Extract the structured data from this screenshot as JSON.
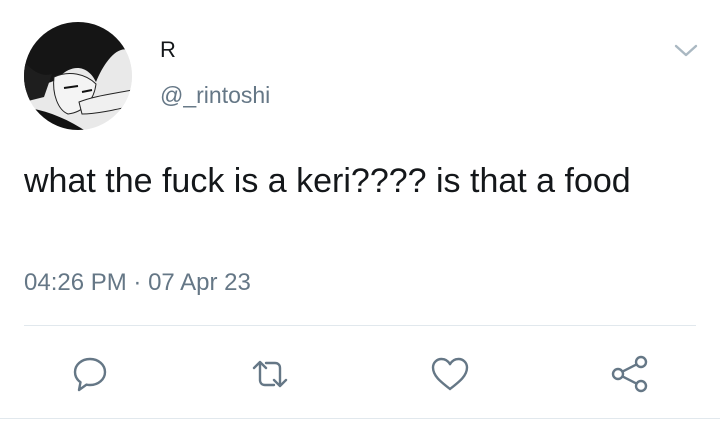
{
  "author": {
    "display_name": "R",
    "handle": "@_rintoshi"
  },
  "tweet": {
    "text": "what the fuck is a keri???? is that a food",
    "time": "04:26 PM",
    "separator": "·",
    "date": "07 Apr 23"
  },
  "actions": {
    "icons": [
      "reply-icon",
      "retweet-icon",
      "like-icon",
      "share-icon"
    ]
  },
  "colors": {
    "text": "#14171a",
    "secondary": "#657786",
    "icon": "#657786",
    "divider": "#e1e8ed"
  }
}
